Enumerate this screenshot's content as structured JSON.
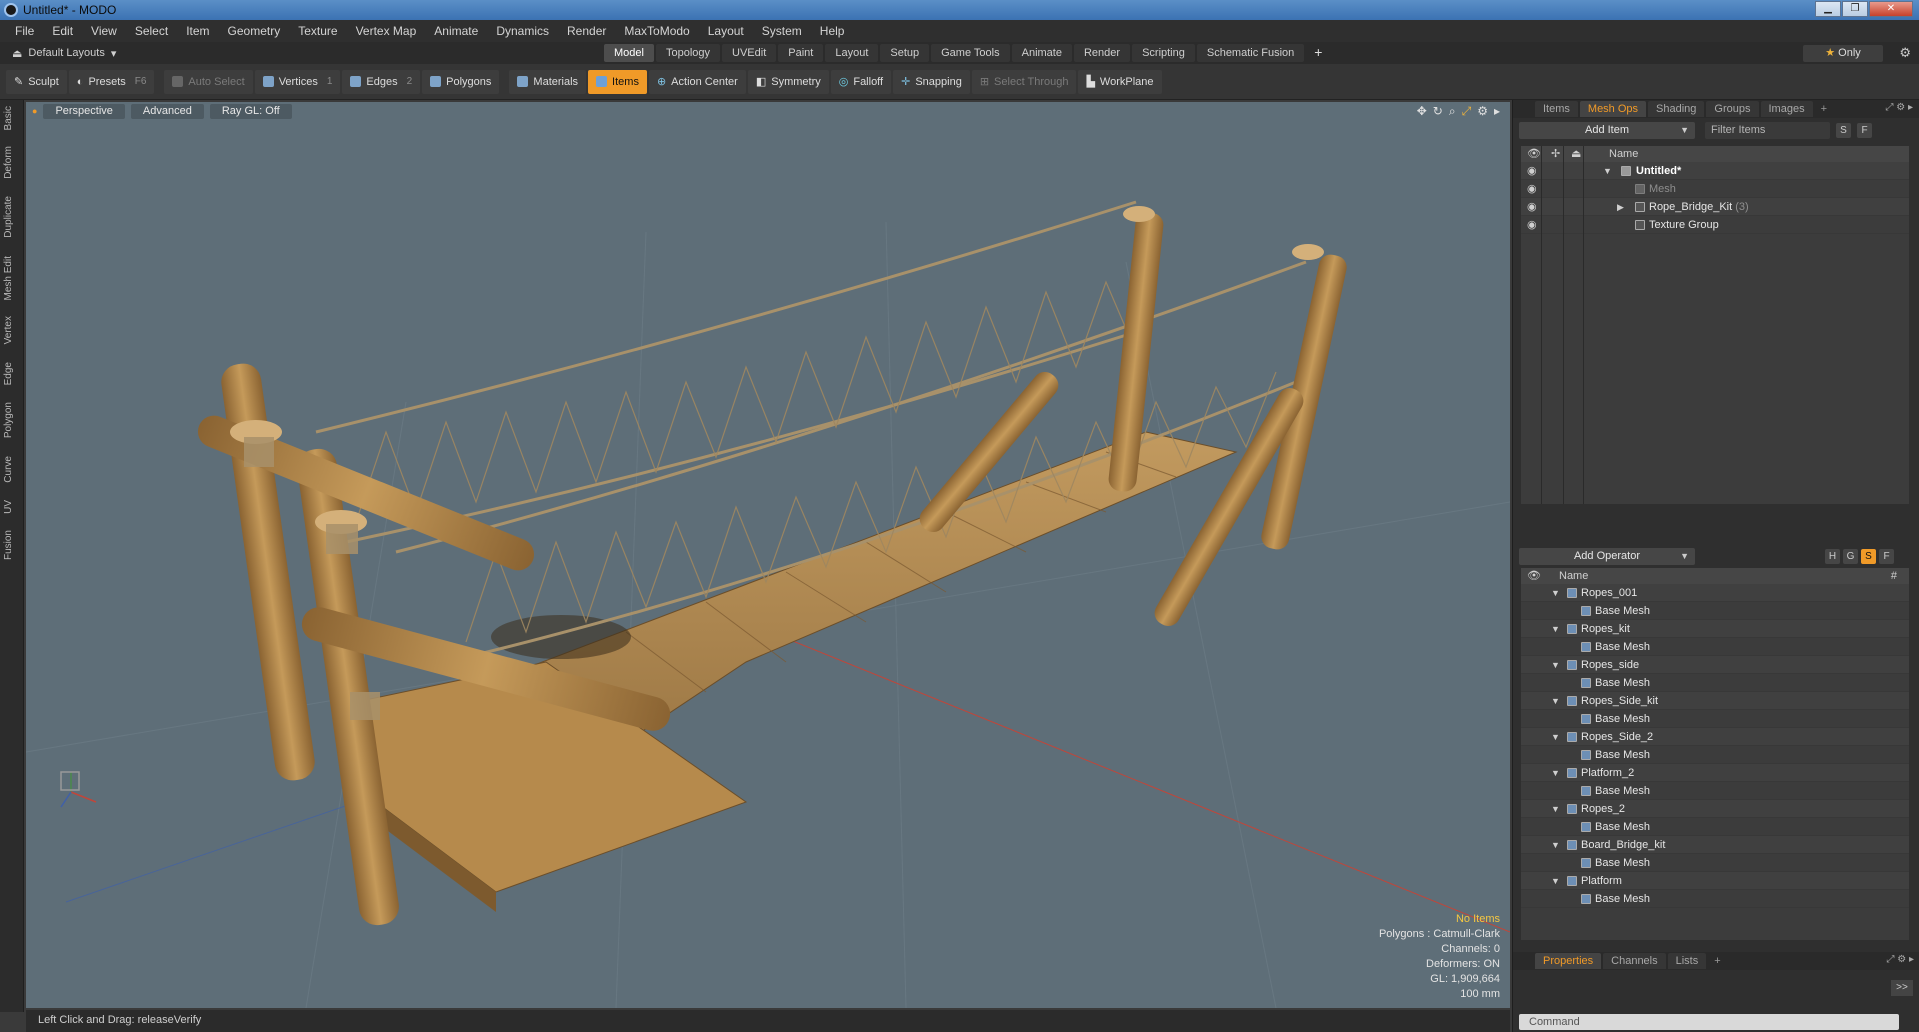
{
  "window": {
    "title": "Untitled* - MODO"
  },
  "menu": [
    "File",
    "Edit",
    "View",
    "Select",
    "Item",
    "Geometry",
    "Texture",
    "Vertex Map",
    "Animate",
    "Dynamics",
    "Render",
    "MaxToModo",
    "Layout",
    "System",
    "Help"
  ],
  "layouts": {
    "label": "Default Layouts"
  },
  "tabs": [
    "Model",
    "Topology",
    "UVEdit",
    "Paint",
    "Layout",
    "Setup",
    "Game Tools",
    "Animate",
    "Render",
    "Scripting",
    "Schematic Fusion"
  ],
  "only_label": "Only",
  "toolbar": {
    "sculpt": "Sculpt",
    "presets": "Presets",
    "presets_key": "F6",
    "auto_select": "Auto Select",
    "vertices": "Vertices",
    "vertices_key": "1",
    "edges": "Edges",
    "edges_key": "2",
    "polygons": "Polygons",
    "materials": "Materials",
    "items": "Items",
    "action_center": "Action Center",
    "symmetry": "Symmetry",
    "falloff": "Falloff",
    "snapping": "Snapping",
    "select_through": "Select Through",
    "workplane": "WorkPlane"
  },
  "left_strip": [
    "Basic",
    "Deform",
    "Duplicate",
    "Mesh Edit",
    "Vertex",
    "Edge",
    "Polygon",
    "Curve",
    "UV",
    "Fusion"
  ],
  "viewport": {
    "view": "Perspective",
    "advanced": "Advanced",
    "raygl": "Ray GL: Off",
    "info": {
      "no_items": "No Items",
      "polygons": "Polygons : Catmull-Clark",
      "channels": "Channels: 0",
      "deformers": "Deformers: ON",
      "gl": "GL: 1,909,664",
      "scale": "100 mm"
    }
  },
  "status": "Left Click and Drag:   releaseVerify",
  "items_panel": {
    "tabs": [
      "Items",
      "Mesh Ops",
      "Shading",
      "Groups",
      "Images"
    ],
    "add_item": "Add Item",
    "filter": "Filter Items",
    "s_btn": "S",
    "f_btn": "F",
    "col_name": "Name",
    "rows": [
      {
        "label": "Untitled*"
      },
      {
        "label": "Mesh"
      },
      {
        "label": "Rope_Bridge_Kit",
        "count": "(3)"
      },
      {
        "label": "Texture Group"
      }
    ]
  },
  "meshops_panel": {
    "add_operator": "Add Operator",
    "h_btn": "H",
    "g_btn": "G",
    "s_btn": "S",
    "f_btn": "F",
    "col_name": "Name",
    "col_hash": "#",
    "groups": [
      {
        "name": "Ropes_001",
        "child": "Base Mesh"
      },
      {
        "name": "Ropes_kit",
        "child": "Base Mesh"
      },
      {
        "name": "Ropes_side",
        "child": "Base Mesh"
      },
      {
        "name": "Ropes_Side_kit",
        "child": "Base Mesh"
      },
      {
        "name": "Ropes_Side_2",
        "child": "Base Mesh"
      },
      {
        "name": "Platform_2",
        "child": "Base Mesh"
      },
      {
        "name": "Ropes_2",
        "child": "Base Mesh"
      },
      {
        "name": "Board_Bridge_kit",
        "child": "Base Mesh"
      },
      {
        "name": "Platform",
        "child": "Base Mesh"
      }
    ]
  },
  "bottom_panel": {
    "tabs": [
      "Properties",
      "Channels",
      "Lists"
    ],
    "command_placeholder": "Command",
    "expand": ">>"
  },
  "colors": {
    "accent": "#f09a28",
    "viewport_bg": "#5e6e78",
    "wood": "#b58a4c",
    "rope": "#a8916a"
  }
}
